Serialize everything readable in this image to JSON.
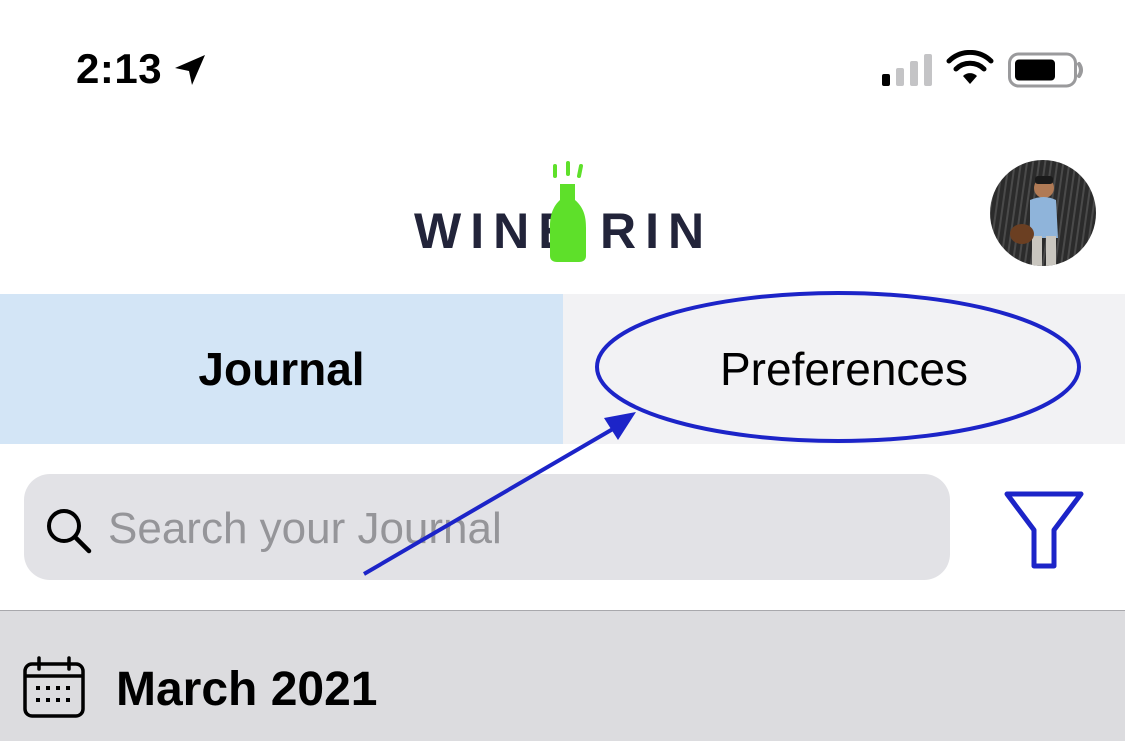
{
  "status_bar": {
    "time": "2:13",
    "icons": [
      "location-arrow-icon",
      "cellular-signal-icon",
      "wifi-icon",
      "battery-icon"
    ]
  },
  "header": {
    "logo_text_left": "WINE",
    "logo_text_right": "RING",
    "logo_icon": "wine-bottle-icon",
    "avatar": "user-avatar"
  },
  "tabs": [
    {
      "label": "Journal",
      "active": true
    },
    {
      "label": "Preferences",
      "active": false
    }
  ],
  "search": {
    "placeholder": "Search your Journal",
    "icon": "search-icon",
    "filter_icon": "filter-icon"
  },
  "section": {
    "month": "March 2021",
    "icon": "calendar-icon"
  },
  "annotation": {
    "type": "circle-and-arrow",
    "target": "Preferences"
  },
  "colors": {
    "active_tab_bg": "#d3e5f6",
    "inactive_tab_bg": "#f2f2f4",
    "logo_green": "#5ee02a",
    "logo_navy": "#22243a",
    "annotation_blue": "#1c24c8",
    "search_bg": "#e2e2e6",
    "section_bg": "#dcdcdf"
  }
}
